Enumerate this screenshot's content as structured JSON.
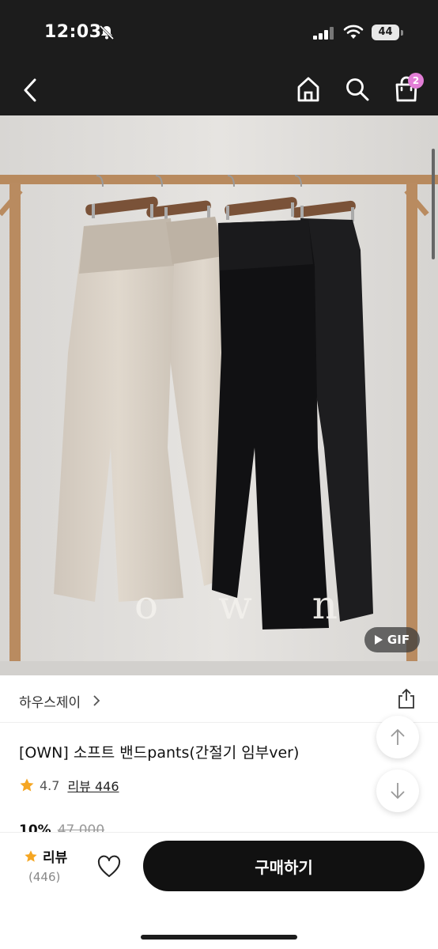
{
  "status_bar": {
    "time": "12:03",
    "battery": "44",
    "icons": [
      "bell-slash-icon",
      "signal-icon",
      "wifi-icon",
      "battery-icon"
    ]
  },
  "nav": {
    "icons": [
      "back-chevron-icon",
      "home-icon",
      "search-icon",
      "shopping-bag-icon"
    ],
    "cart_count": "2"
  },
  "product_image": {
    "watermark": "o w n",
    "gif_label": "GIF"
  },
  "brand": {
    "name": "하우스제이"
  },
  "product": {
    "title": "[OWN] 소프트 밴드pants(간절기 임부ver)",
    "rating": "4.7",
    "review_link": "리뷰 446",
    "discount": "10%",
    "original_price": "47,000"
  },
  "bottom_bar": {
    "review_label": "리뷰",
    "review_count": "(446)",
    "buy_label": "구매하기"
  },
  "colors": {
    "accent_star": "#f5a623",
    "cart_badge": "#e27ed6",
    "buy_button": "#111111"
  }
}
